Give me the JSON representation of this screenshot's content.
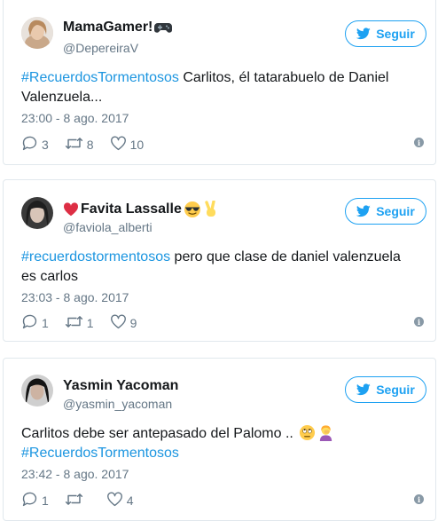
{
  "tweets": [
    {
      "display_name": "MamaGamer!",
      "handle": "@DepereiraV",
      "follow_label": "Seguir",
      "hashtag": "#RecuerdosTormentosos",
      "body": " Carlitos, él tatarabuelo de Daniel Valenzuela...",
      "timestamp": "23:00 - 8 ago. 2017",
      "replies": "3",
      "retweets": "8",
      "likes": "10",
      "emojis": [
        "gamepad-emoji"
      ]
    },
    {
      "display_name": "Favita Lassalle",
      "handle": "@faviola_alberti",
      "follow_label": "Seguir",
      "hashtag": "#recuerdostormentosos",
      "body": " pero que clase de daniel valenzuela es carlos",
      "timestamp": "23:03 - 8 ago. 2017",
      "replies": "1",
      "retweets": "1",
      "likes": "9",
      "emojis": [
        "red-heart-emoji",
        "sunglasses-emoji",
        "victory-hand-emoji"
      ]
    },
    {
      "display_name": "Yasmin Yacoman",
      "handle": "@yasmin_yacoman",
      "follow_label": "Seguir",
      "body": "Carlitos debe ser antepasado del Palomo .. ",
      "hashtag": "#RecuerdosTormentosos",
      "timestamp": "23:42 - 8 ago. 2017",
      "replies": "1",
      "retweets": "",
      "likes": "4",
      "emojis": [
        "eye-roll-emoji",
        "person-facepalming-emoji"
      ]
    }
  ],
  "colors": {
    "accent": "#1da1f2",
    "hashtag": "#1b95e0",
    "muted": "#657786",
    "border": "#e1e8ed"
  }
}
